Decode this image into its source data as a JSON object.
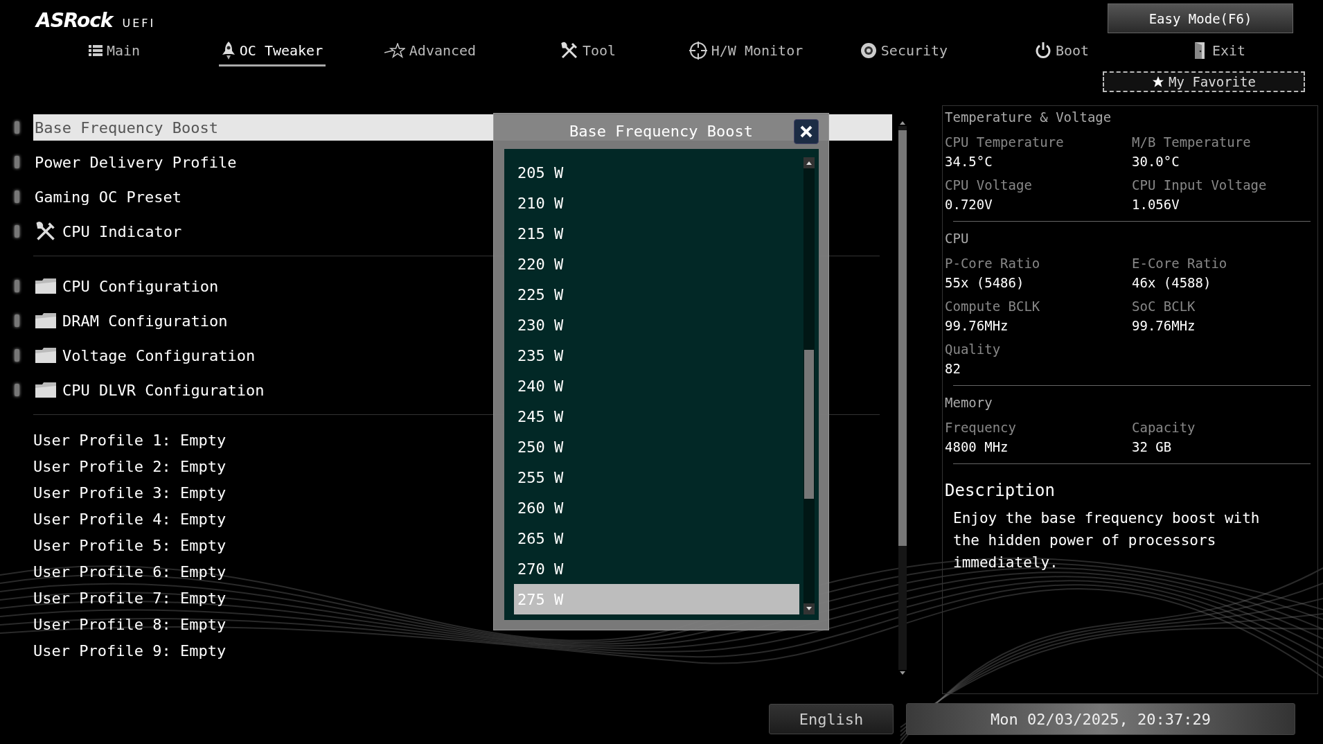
{
  "logo": {
    "brand": "ASRock",
    "product": "UEFI"
  },
  "easy_mode_button": "Easy Mode(F6)",
  "tabs": [
    {
      "label": "Main",
      "selected": false
    },
    {
      "label": "OC Tweaker",
      "selected": true
    },
    {
      "label": "Advanced",
      "selected": false
    },
    {
      "label": "Tool",
      "selected": false
    },
    {
      "label": "H/W Monitor",
      "selected": false
    },
    {
      "label": "Security",
      "selected": false
    },
    {
      "label": "Boot",
      "selected": false
    },
    {
      "label": "Exit",
      "selected": false
    }
  ],
  "favorite_button": "My Favorite",
  "menu_sections": [
    {
      "items": [
        {
          "label": "Base Frequency Boost",
          "kind": "setting",
          "selected": true
        },
        {
          "label": "Power Delivery Profile",
          "kind": "setting",
          "selected": false
        },
        {
          "label": "Gaming OC Preset",
          "kind": "setting",
          "selected": false
        },
        {
          "label": "CPU Indicator",
          "kind": "tool",
          "selected": false
        }
      ]
    },
    {
      "items": [
        {
          "label": "CPU Configuration",
          "kind": "folder",
          "selected": false
        },
        {
          "label": "DRAM Configuration",
          "kind": "folder",
          "selected": false
        },
        {
          "label": "Voltage Configuration",
          "kind": "folder",
          "selected": false
        },
        {
          "label": "CPU DLVR Configuration",
          "kind": "folder",
          "selected": false
        }
      ]
    }
  ],
  "user_profiles": [
    "User Profile 1: Empty",
    "User Profile 2: Empty",
    "User Profile 3: Empty",
    "User Profile 4: Empty",
    "User Profile 5: Empty",
    "User Profile 6: Empty",
    "User Profile 7: Empty",
    "User Profile 8: Empty",
    "User Profile 9: Empty"
  ],
  "dialog": {
    "title": "Base Frequency Boost",
    "options": [
      {
        "label": "205 W",
        "selected": false
      },
      {
        "label": "210 W",
        "selected": false
      },
      {
        "label": "215 W",
        "selected": false
      },
      {
        "label": "220 W",
        "selected": false
      },
      {
        "label": "225 W",
        "selected": false
      },
      {
        "label": "230 W",
        "selected": false
      },
      {
        "label": "235 W",
        "selected": false
      },
      {
        "label": "240 W",
        "selected": false
      },
      {
        "label": "245 W",
        "selected": false
      },
      {
        "label": "250 W",
        "selected": false
      },
      {
        "label": "255 W",
        "selected": false
      },
      {
        "label": "260 W",
        "selected": false
      },
      {
        "label": "265 W",
        "selected": false
      },
      {
        "label": "270 W",
        "selected": false
      },
      {
        "label": "275 W",
        "selected": true
      }
    ]
  },
  "hardware_panel": {
    "groups": [
      {
        "title": "Temperature & Voltage",
        "fields": [
          {
            "label": "CPU Temperature",
            "value": "34.5°C"
          },
          {
            "label": "M/B Temperature",
            "value": "30.0°C"
          },
          {
            "label": "CPU Voltage",
            "value": "0.720V"
          },
          {
            "label": "CPU Input Voltage",
            "value": "1.056V"
          }
        ]
      },
      {
        "title": "CPU",
        "fields": [
          {
            "label": "P-Core Ratio",
            "value": "55x (5486)"
          },
          {
            "label": "E-Core Ratio",
            "value": "46x (4588)"
          },
          {
            "label": "Compute BCLK",
            "value": "99.76MHz"
          },
          {
            "label": "SoC BCLK",
            "value": "99.76MHz"
          },
          {
            "label": "Quality",
            "value": "82"
          }
        ]
      },
      {
        "title": "Memory",
        "fields": [
          {
            "label": "Frequency",
            "value": "4800 MHz"
          },
          {
            "label": "Capacity",
            "value": "32 GB"
          }
        ]
      }
    ]
  },
  "description": {
    "title": "Description",
    "text": "Enjoy the base frequency boost with the hidden power of processors immediately."
  },
  "status_bar": {
    "language": "English",
    "datetime": "Mon 02/03/2025, 20:37:29"
  }
}
